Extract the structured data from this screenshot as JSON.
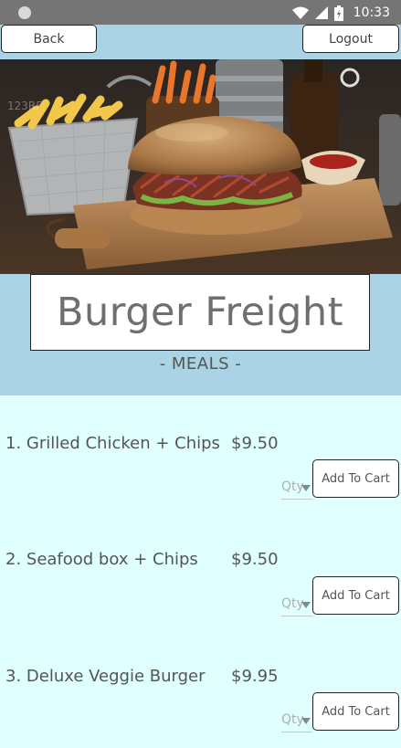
{
  "status_bar": {
    "time": "10:33",
    "icons": [
      "wifi-icon",
      "signal-icon",
      "battery-icon"
    ]
  },
  "header": {
    "back_label": "Back",
    "logout_label": "Logout"
  },
  "hero": {
    "image_description": "Pulled pork burger on a wooden board with fries in a wire basket"
  },
  "brand": {
    "title": "Burger Freight",
    "subtitle": "- MEALS -"
  },
  "menu": {
    "items": [
      {
        "name": "1. Grilled Chicken + Chips",
        "price": "$9.50",
        "qty_placeholder": "Qty",
        "button_label": "Add To Cart"
      },
      {
        "name": "2. Seafood box + Chips",
        "price": "$9.50",
        "qty_placeholder": "Qty",
        "button_label": "Add To Cart"
      },
      {
        "name": "3. Deluxe Veggie Burger",
        "price": "$9.95",
        "qty_placeholder": "Qty",
        "button_label": "Add To Cart"
      }
    ]
  },
  "colors": {
    "status_bar": "#757575",
    "header_band": "#aad3e6",
    "menu_background": "#e0ffff"
  }
}
